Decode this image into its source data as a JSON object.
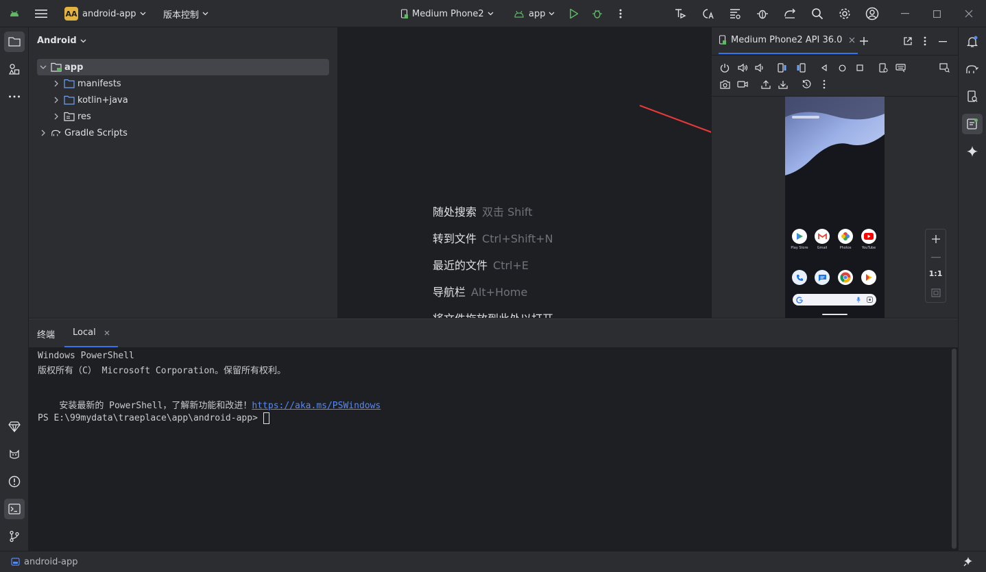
{
  "titlebar": {
    "project_badge": "AA",
    "project_name": "android-app",
    "vcs_label": "版本控制",
    "device_name": "Medium Phone2",
    "run_config": "app"
  },
  "project_panel": {
    "view_mode": "Android",
    "tree": [
      {
        "label": "app",
        "selected": true
      },
      {
        "label": "manifests"
      },
      {
        "label": "kotlin+java"
      },
      {
        "label": "res"
      },
      {
        "label": "Gradle Scripts"
      }
    ]
  },
  "editor_hints": [
    {
      "action": "随处搜索",
      "shortcut": "双击 Shift"
    },
    {
      "action": "转到文件",
      "shortcut": "Ctrl+Shift+N"
    },
    {
      "action": "最近的文件",
      "shortcut": "Ctrl+E"
    },
    {
      "action": "导航栏",
      "shortcut": "Alt+Home"
    },
    {
      "action": "将文件拖放到此处以打开",
      "shortcut": ""
    }
  ],
  "devices_panel": {
    "tab_label": "Medium Phone2 API 36.0",
    "zoom_label": "1:1",
    "phone": {
      "apps_row1": [
        "Play Store",
        "Gmail",
        "Photos",
        "YouTube"
      ]
    }
  },
  "terminal": {
    "tab_title": "终端",
    "session_tab": "Local",
    "lines": {
      "l1": "Windows PowerShell",
      "l2": "版权所有（C） Microsoft Corporation。保留所有权利。",
      "l3_prefix": "安装最新的 PowerShell，了解新功能和改进！",
      "l3_link": "https://aka.ms/PSWindows",
      "prompt": "PS E:\\99mydata\\traeplace\\app\\android-app> "
    }
  },
  "statusbar": {
    "project": "android-app"
  },
  "colors": {
    "accent_badge": "#e3b341",
    "run_green": "#5fb865",
    "link_blue": "#548af7",
    "arrow_red": "#e5393a"
  }
}
